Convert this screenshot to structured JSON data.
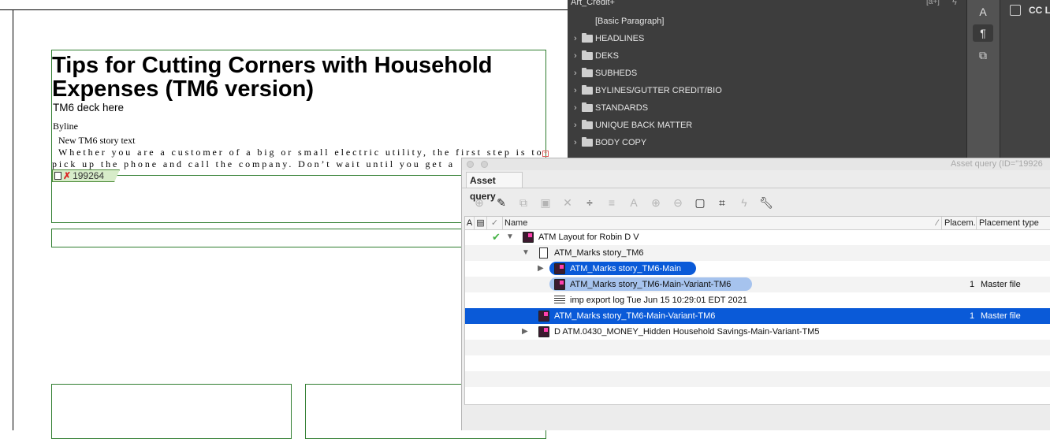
{
  "document": {
    "headline": "Tips for Cutting Corners with Household Expenses (TM6 version)",
    "deck": "TM6 deck here",
    "byline": "Byline",
    "story_head": "New TM6 story text",
    "body_line1": "Whether you are a customer of a big or small electric utility, the first step is to",
    "body_line2": "pick up the phone and call the company. Don’t wait until you get a",
    "tag_id": "199264",
    "frame_color": "#2f7d2f"
  },
  "paragraph_panel": {
    "title": "Art_Credit+",
    "title_badge": "[a+]",
    "basic_paragraph": "[Basic Paragraph]",
    "groups": [
      {
        "label": "HEADLINES"
      },
      {
        "label": "DEKS"
      },
      {
        "label": "SUBHEDS"
      },
      {
        "label": "BYLINES/GUTTER CREDIT/BIO"
      },
      {
        "label": "STANDARDS"
      },
      {
        "label": "UNIQUE BACK MATTER"
      },
      {
        "label": "BODY COPY"
      }
    ]
  },
  "cc_panel": {
    "label": "CC L"
  },
  "asset_query": {
    "window_title": "Asset query (ID=\"19926",
    "tab": "Asset query",
    "columns": {
      "name": "Name",
      "placements": "Placem.",
      "placement_type": "Placement type"
    },
    "rows": [
      {
        "name": "ATM Layout for Robin D V",
        "count": "",
        "type": ""
      },
      {
        "name": "ATM_Marks story_TM6",
        "count": "",
        "type": ""
      },
      {
        "name": "ATM_Marks story_TM6-Main",
        "count": "",
        "type": ""
      },
      {
        "name": "ATM_Marks story_TM6-Main-Variant-TM6",
        "count": "1",
        "type": "Master file"
      },
      {
        "name": "imp export log Tue Jun 15 10:29:01 EDT 2021",
        "count": "",
        "type": ""
      },
      {
        "name": "ATM_Marks story_TM6-Main-Variant-TM6",
        "count": "1",
        "type": "Master file"
      },
      {
        "name": "D ATM.0430_MONEY_Hidden Household Savings-Main-Variant-TM5",
        "count": "",
        "type": ""
      }
    ],
    "selection_color": "#0a5ad8"
  }
}
